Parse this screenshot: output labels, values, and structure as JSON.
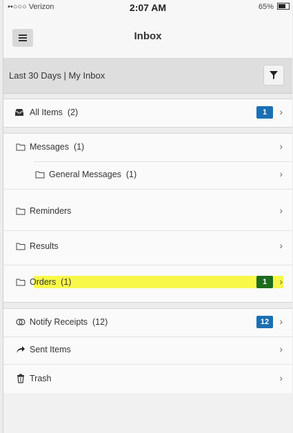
{
  "status_bar": {
    "carrier": "••○○○ Verizon",
    "time": "2:07 AM",
    "battery": "65%"
  },
  "header": {
    "title": "Inbox",
    "menu_icon": "hamburger-menu-icon"
  },
  "filter_bar": {
    "text": "Last 30 Days | My Inbox",
    "filter_icon": "funnel-icon"
  },
  "colors": {
    "badge_blue": "#1a6fb3",
    "badge_green": "#1d6b1d",
    "highlight": "#f7f72a"
  },
  "folders": {
    "all_items": {
      "label": "All Items",
      "count": "(2)",
      "badge": "1",
      "icon": "inbox-tray-icon"
    },
    "messages": {
      "label": "Messages",
      "count": "(1)",
      "icon": "folder-icon"
    },
    "general_messages": {
      "label": "General Messages",
      "count": "(1)",
      "icon": "folder-icon"
    },
    "reminders": {
      "label": "Reminders",
      "icon": "folder-icon"
    },
    "results": {
      "label": "Results",
      "icon": "folder-icon"
    },
    "orders": {
      "label": "Orders",
      "count": "(1)",
      "badge": "1",
      "icon": "folder-icon",
      "highlighted": true
    },
    "notify_receipts": {
      "label": "Notify Receipts",
      "count": "(12)",
      "badge": "12",
      "icon": "receipt-icon"
    },
    "sent_items": {
      "label": "Sent Items",
      "icon": "sent-arrow-icon"
    },
    "trash": {
      "label": "Trash",
      "icon": "trash-icon"
    }
  },
  "chevron": "›"
}
